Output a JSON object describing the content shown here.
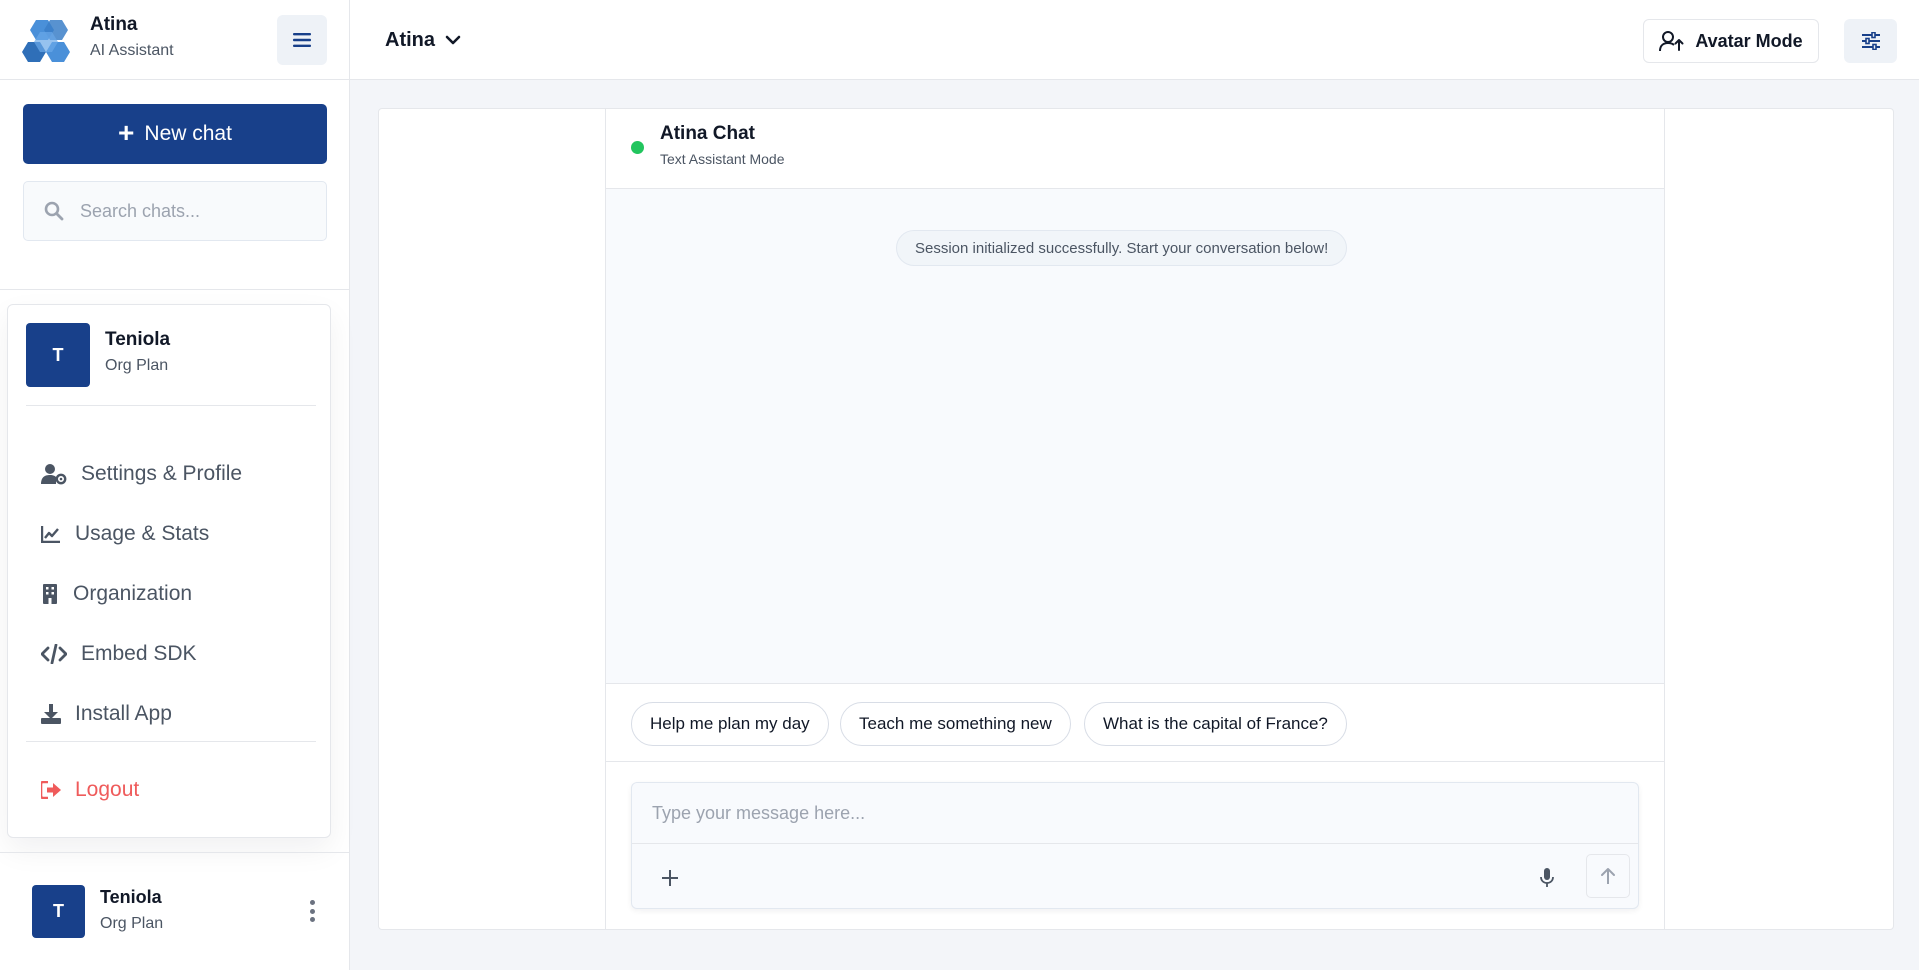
{
  "app": {
    "name": "Atina",
    "subtitle": "AI Assistant"
  },
  "sidebar": {
    "new_chat_label": "New chat",
    "search_placeholder": "Search chats...",
    "profile": {
      "initial": "T",
      "name": "Teniola",
      "plan": "Org Plan"
    },
    "menu": [
      {
        "label": "Settings & Profile",
        "icon": "user-gear-icon"
      },
      {
        "label": "Usage & Stats",
        "icon": "chart-line-icon"
      },
      {
        "label": "Organization",
        "icon": "building-icon"
      },
      {
        "label": "Embed SDK",
        "icon": "code-icon"
      },
      {
        "label": "Install App",
        "icon": "download-icon"
      }
    ],
    "logout_label": "Logout",
    "footer_user": {
      "initial": "T",
      "name": "Teniola",
      "plan": "Org Plan"
    }
  },
  "topbar": {
    "agent_name": "Atina",
    "avatar_mode_label": "Avatar Mode"
  },
  "chat": {
    "title": "Atina Chat",
    "mode": "Text Assistant Mode",
    "system_message": "Session initialized successfully. Start your conversation below!",
    "suggestions": [
      "Help me plan my day",
      "Teach me something new",
      "What is the capital of France?"
    ],
    "input_placeholder": "Type your message here..."
  },
  "colors": {
    "primary": "#18408a",
    "status_online": "#22c55e",
    "logout": "#ef5b5b",
    "logo_blue": "#4a90d9"
  }
}
